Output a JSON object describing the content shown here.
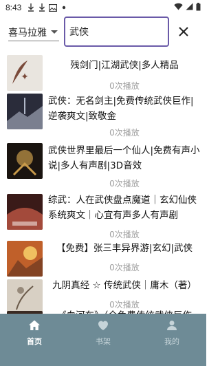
{
  "status_bar": {
    "time": "8:43",
    "icons": [
      "download-icon",
      "download-icon",
      "image-icon",
      "dot-icon",
      "wifi-icon",
      "signal-icon",
      "battery-icon"
    ]
  },
  "search": {
    "platform_value": "喜马拉雅",
    "query": "武侠",
    "close_icon": "close-icon"
  },
  "results": [
    {
      "title": "残剑门|江湖武侠|多人精品",
      "plays": "0次播放",
      "cover_colors": [
        "#e9e5df",
        "#7a4a3a"
      ]
    },
    {
      "title": "武侠：无名剑主|免费传统武侠巨作|逆袭爽文|致敬金",
      "plays": "0次播放",
      "cover_colors": [
        "#2a2c3a",
        "#b0b8c8"
      ]
    },
    {
      "title": "武侠世界里最后一个仙人|免费有声小说|多人有声剧|3D音效",
      "plays": "0次播放",
      "cover_colors": [
        "#1a1410",
        "#c89a4a"
      ]
    },
    {
      "title": "综武：人在武侠盘点魔道｜玄幻仙侠系统爽文｜心宜有声多人有声剧",
      "plays": "0次播放",
      "cover_colors": [
        "#3a1a18",
        "#d0604a"
      ]
    },
    {
      "title": "【免费】张三丰异界游|玄幻|武侠",
      "plays": "0次播放",
      "cover_colors": [
        "#c0602a",
        "#f0c060"
      ]
    },
    {
      "title": "九阴真经 ☆ 传统武侠｜庸木（著）",
      "plays": "0次播放",
      "cover_colors": [
        "#d8d0c4",
        "#6a5a4a"
      ]
    },
    {
      "title": "《血河车》（全免费传统武侠巨作",
      "plays": "",
      "cover_colors": [
        "#3a2a22",
        "#a07050"
      ]
    }
  ],
  "nav": {
    "home_label": "首页",
    "shelf_label": "书架",
    "mine_label": "我的",
    "active": "home"
  },
  "colors": {
    "accent": "#6a5aa8",
    "nav_bg": "#6e8b96",
    "muted_text": "#a0a0a0"
  }
}
